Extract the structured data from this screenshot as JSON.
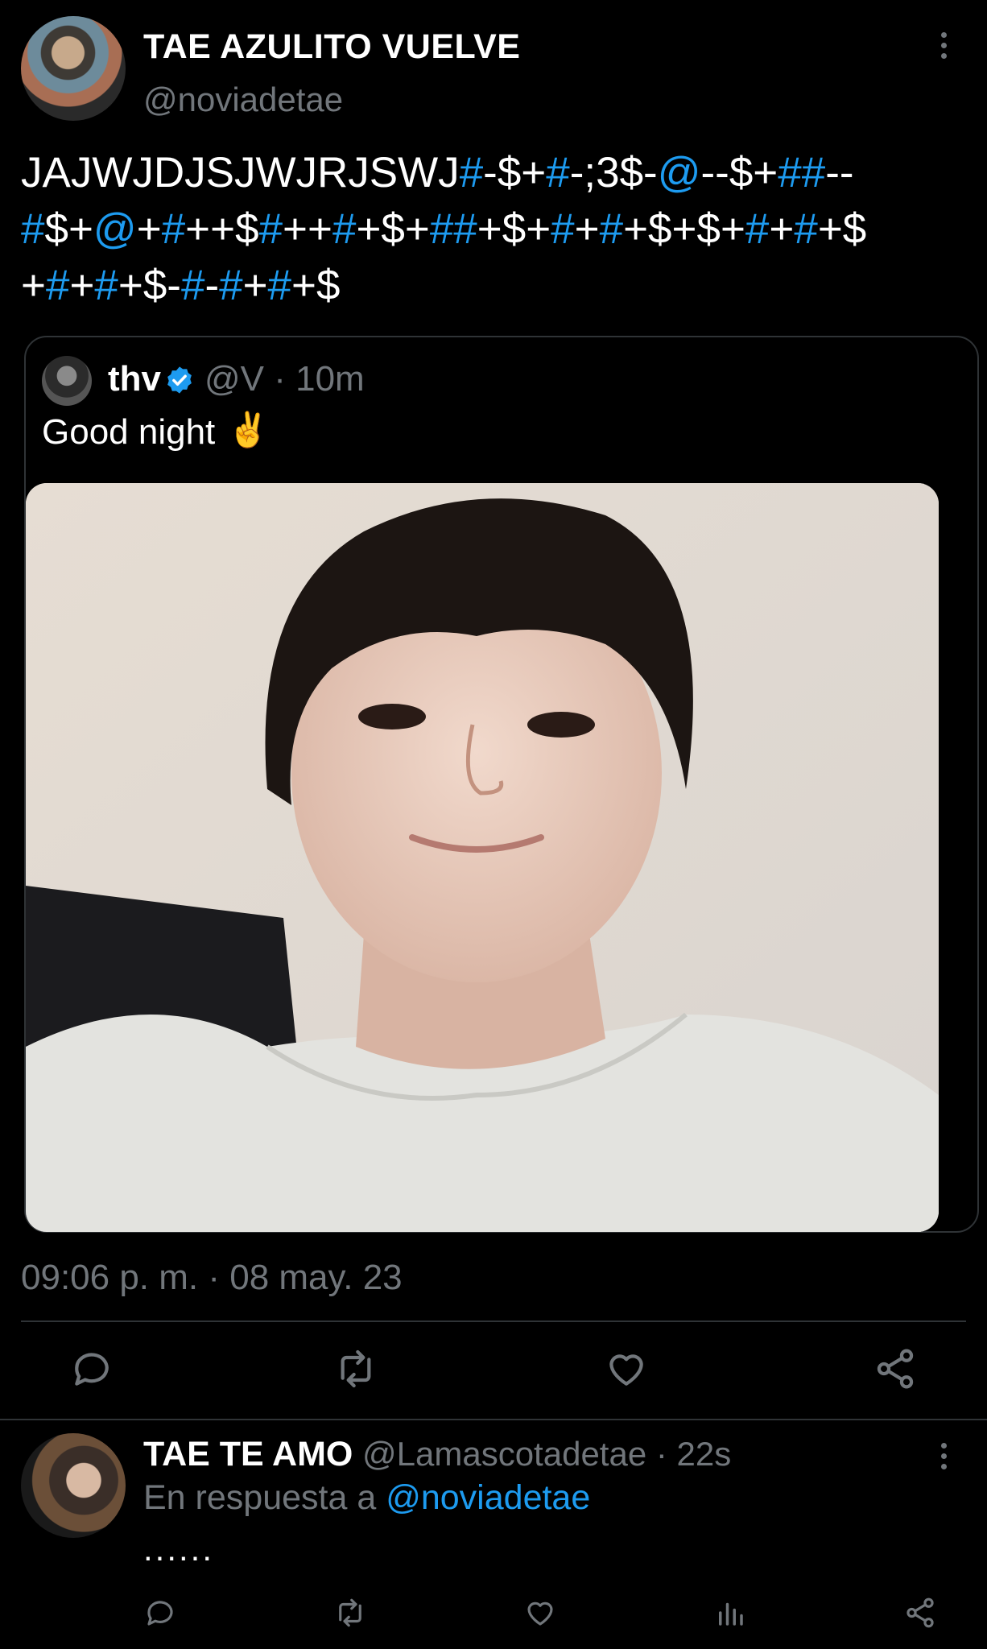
{
  "main_tweet": {
    "display_name": "TAE AZULITO VUELVE",
    "handle": "@noviadetae",
    "text_segments": [
      [
        {
          "t": "JAJWJDJSJWJRJSWJ",
          "c": "w"
        },
        {
          "t": "#",
          "c": "b"
        },
        {
          "t": "-$+",
          "c": "w"
        },
        {
          "t": "#",
          "c": "b"
        },
        {
          "t": "-;3$-",
          "c": "w"
        },
        {
          "t": "@",
          "c": "b"
        },
        {
          "t": "--$+",
          "c": "w"
        },
        {
          "t": "##",
          "c": "b"
        },
        {
          "t": "--",
          "c": "w"
        }
      ],
      [
        {
          "t": "#",
          "c": "b"
        },
        {
          "t": "$+",
          "c": "w"
        },
        {
          "t": "@",
          "c": "b"
        },
        {
          "t": "+",
          "c": "w"
        },
        {
          "t": "#",
          "c": "b"
        },
        {
          "t": "++$",
          "c": "w"
        },
        {
          "t": "#",
          "c": "b"
        },
        {
          "t": "++",
          "c": "w"
        },
        {
          "t": "#",
          "c": "b"
        },
        {
          "t": "+$+",
          "c": "w"
        },
        {
          "t": "##",
          "c": "b"
        },
        {
          "t": "+$+",
          "c": "w"
        },
        {
          "t": "#",
          "c": "b"
        },
        {
          "t": "+",
          "c": "w"
        },
        {
          "t": "#",
          "c": "b"
        },
        {
          "t": "+$+$+",
          "c": "w"
        },
        {
          "t": "#",
          "c": "b"
        },
        {
          "t": "+",
          "c": "w"
        },
        {
          "t": "#",
          "c": "b"
        },
        {
          "t": "+$",
          "c": "w"
        }
      ],
      [
        {
          "t": "+",
          "c": "w"
        },
        {
          "t": "#",
          "c": "b"
        },
        {
          "t": "+",
          "c": "w"
        },
        {
          "t": "#",
          "c": "b"
        },
        {
          "t": "+$-",
          "c": "w"
        },
        {
          "t": "#",
          "c": "b"
        },
        {
          "t": "-",
          "c": "w"
        },
        {
          "t": "#",
          "c": "b"
        },
        {
          "t": "+",
          "c": "w"
        },
        {
          "t": "#",
          "c": "b"
        },
        {
          "t": "+$",
          "c": "w"
        }
      ]
    ],
    "timestamp": "09:06 p. m. · 08 may. 23"
  },
  "quoted_tweet": {
    "display_name": "thv",
    "handle_time": "@V · 10m",
    "text": "Good night",
    "emoji": "✌",
    "verified_icon": "verified-badge-icon",
    "photo_icon": "selfie-photo"
  },
  "actions": [
    "reply-icon",
    "retweet-icon",
    "like-icon",
    "share-icon"
  ],
  "reply_tweet": {
    "display_name": "TAE TE AMO",
    "handle_time": "@Lamascotadetae · 22s",
    "context_prefix": "En respuesta a",
    "context_handle": "@noviadetae",
    "text": "......",
    "actions": [
      "reply-icon",
      "retweet-icon",
      "like-icon",
      "views-icon",
      "share-icon"
    ]
  },
  "colors": {
    "background": "#000000",
    "text": "#e7e9ea",
    "dim": "#71767b",
    "accent": "#1d9bf0",
    "border": "#2f3336"
  }
}
